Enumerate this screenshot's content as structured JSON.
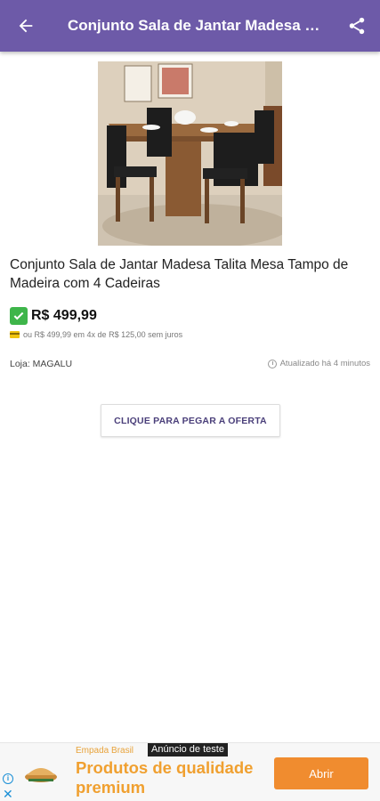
{
  "appbar": {
    "title": "Conjunto Sala de Jantar Madesa Talita Mesa Tampo de Madeira com 4 Cadeiras",
    "back_icon": "arrow-back-icon",
    "share_icon": "share-icon"
  },
  "product": {
    "title": "Conjunto Sala de Jantar Madesa Talita Mesa Tampo de Madeira com 4 Cadeiras",
    "price": "R$ 499,99",
    "installments": "ou R$ 499,99 em 4x de R$ 125,00 sem juros",
    "store": "Loja: MAGALU",
    "updated": "Atualizado há 4 minutos",
    "offer_button": "CLIQUE PARA PEGAR A OFERTA"
  },
  "ad": {
    "badge": "Anúncio de teste",
    "brand": "Empada Brasil",
    "headline": "Produtos de qualidade premium",
    "cta": "Abrir"
  },
  "colors": {
    "appbar": "#6d5aa8",
    "accent_orange": "#f08c2f",
    "check_green": "#3eb54a"
  }
}
